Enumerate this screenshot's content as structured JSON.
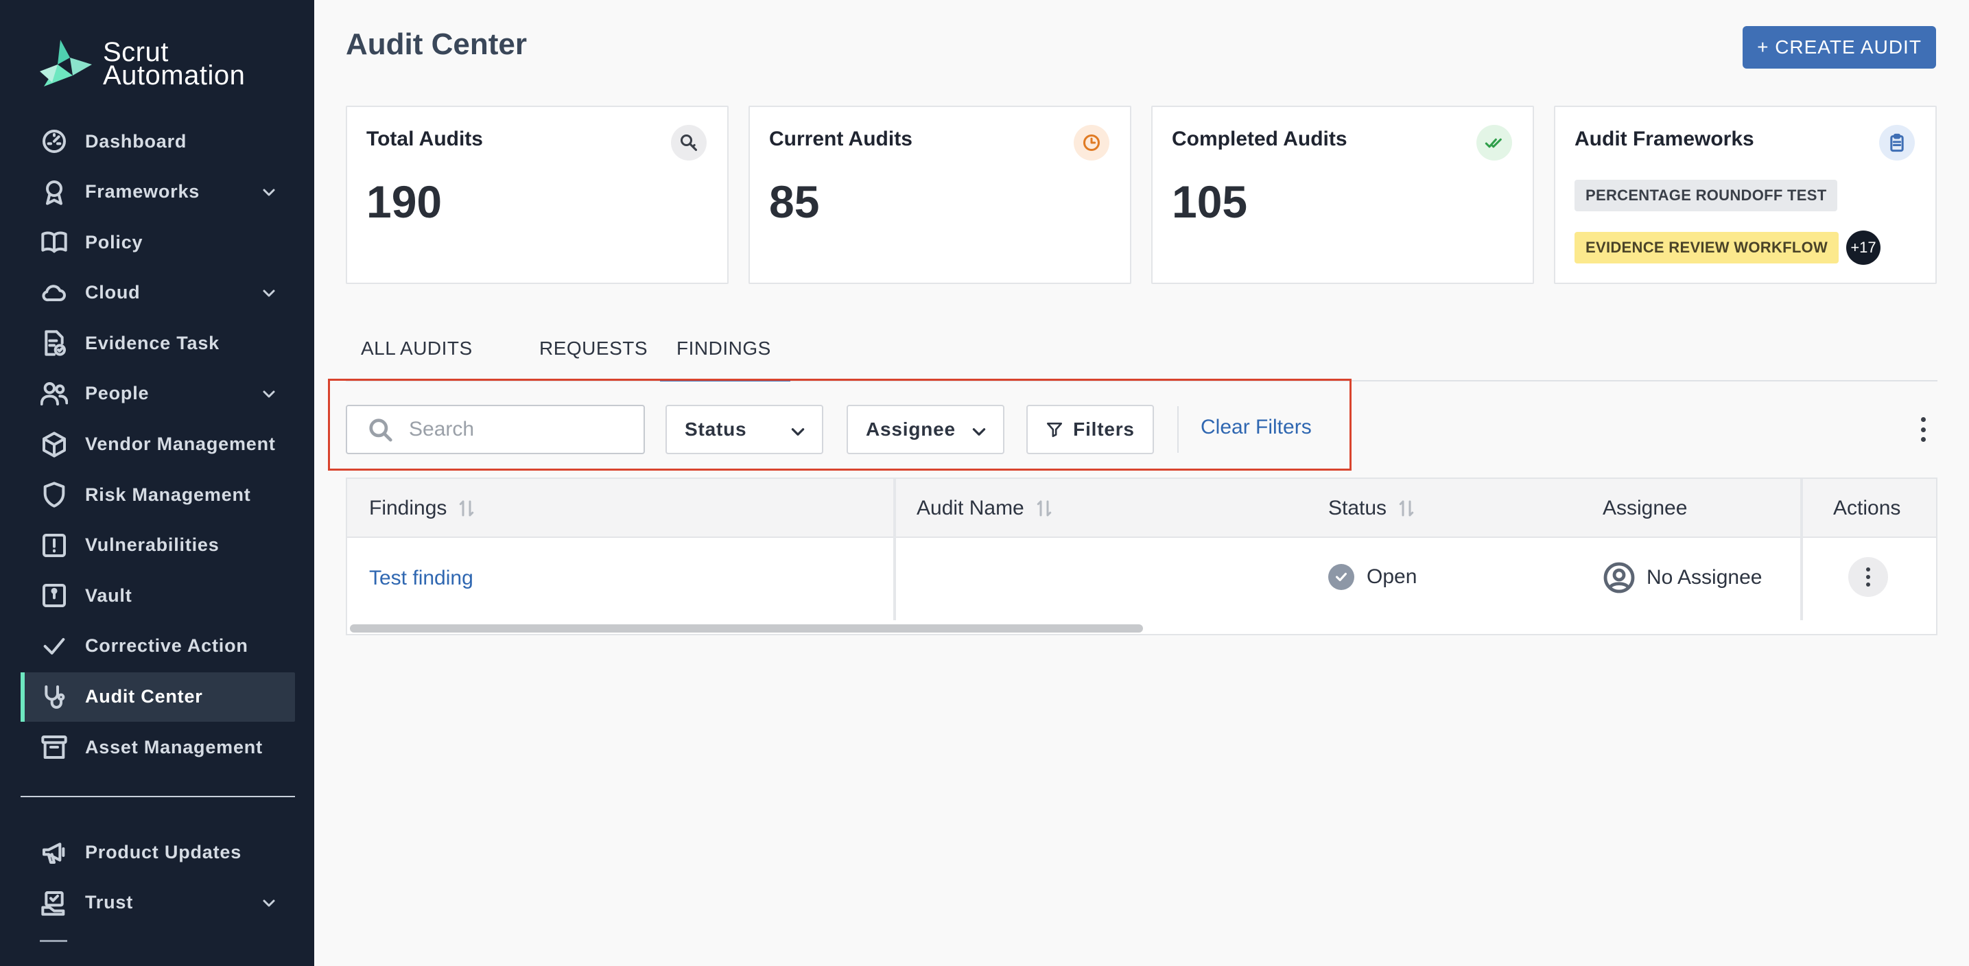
{
  "app": {
    "brand_line1": "Scrut",
    "brand_line2": "Automation"
  },
  "sidebar": {
    "items": [
      {
        "label": "Dashboard",
        "icon": "dashboard-icon",
        "chevron": false,
        "active": false
      },
      {
        "label": "Frameworks",
        "icon": "award-icon",
        "chevron": true,
        "active": false
      },
      {
        "label": "Policy",
        "icon": "book-icon",
        "chevron": false,
        "active": false
      },
      {
        "label": "Cloud",
        "icon": "cloud-icon",
        "chevron": true,
        "active": false
      },
      {
        "label": "Evidence Task",
        "icon": "document-check-icon",
        "chevron": false,
        "active": false
      },
      {
        "label": "People",
        "icon": "people-icon",
        "chevron": true,
        "active": false
      },
      {
        "label": "Vendor Management",
        "icon": "box-icon",
        "chevron": false,
        "active": false
      },
      {
        "label": "Risk Management",
        "icon": "shield-icon",
        "chevron": false,
        "active": false
      },
      {
        "label": "Vulnerabilities",
        "icon": "alert-square-icon",
        "chevron": false,
        "active": false
      },
      {
        "label": "Vault",
        "icon": "vault-icon",
        "chevron": false,
        "active": false
      },
      {
        "label": "Corrective Action",
        "icon": "check-icon",
        "chevron": false,
        "active": false
      },
      {
        "label": "Audit Center",
        "icon": "stethoscope-icon",
        "chevron": false,
        "active": true
      },
      {
        "label": "Asset Management",
        "icon": "archive-icon",
        "chevron": false,
        "active": false
      }
    ],
    "bottom_items": [
      {
        "label": "Product Updates",
        "icon": "megaphone-icon",
        "chevron": false
      },
      {
        "label": "Trust",
        "icon": "trust-icon",
        "chevron": true
      }
    ]
  },
  "header": {
    "title": "Audit Center",
    "create_button": "+ CREATE AUDIT"
  },
  "cards": {
    "total": {
      "title": "Total Audits",
      "value": "190",
      "icon": "search-key-icon"
    },
    "current": {
      "title": "Current Audits",
      "value": "85",
      "icon": "clock-icon"
    },
    "completed": {
      "title": "Completed Audits",
      "value": "105",
      "icon": "double-check-icon"
    },
    "frameworks": {
      "title": "Audit Frameworks",
      "icon": "clipboard-icon",
      "tag1": "PERCENTAGE ROUNDOFF TEST",
      "tag2": "EVIDENCE REVIEW WORKFLOW",
      "more": "+17"
    }
  },
  "tabs": {
    "all": "ALL AUDITS",
    "requests": "REQUESTS",
    "findings": "FINDINGS",
    "active": "FINDINGS"
  },
  "toolbar": {
    "search_placeholder": "Search",
    "status_label": "Status",
    "assignee_label": "Assignee",
    "filters_label": "Filters",
    "clear_label": "Clear Filters"
  },
  "table": {
    "headers": {
      "findings": "Findings",
      "audit_name": "Audit Name",
      "status": "Status",
      "assignee": "Assignee",
      "actions": "Actions"
    },
    "rows": [
      {
        "finding": "Test finding",
        "audit_name": "",
        "status": "Open",
        "assignee": "No Assignee"
      }
    ]
  },
  "colors": {
    "sidebar_bg": "#172030",
    "accent": "#3f6fb5",
    "active_marker": "#6ee7c0",
    "highlight_box": "#d9442e"
  }
}
